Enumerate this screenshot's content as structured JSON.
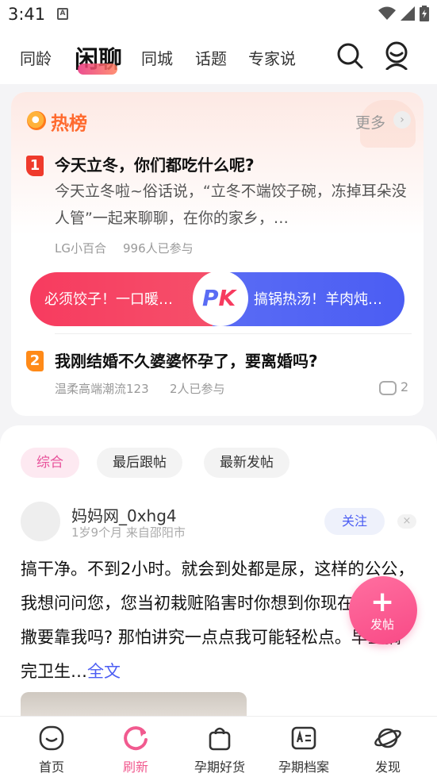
{
  "status_bar": {
    "time": "3:41",
    "notif_glyph": "A"
  },
  "nav": {
    "tabs": [
      {
        "label": "同龄"
      },
      {
        "label": "闲聊",
        "active": true
      },
      {
        "label": "同城"
      },
      {
        "label": "话题"
      },
      {
        "label": "专家说"
      }
    ],
    "search_icon": "search-icon",
    "profile_icon": "user-icon"
  },
  "hot_list": {
    "title": "热榜",
    "more_label": "更多",
    "more_arrow": "›",
    "items": [
      {
        "rank": "1",
        "title": "今天立冬，你们都吃什么呢?",
        "desc": "今天立冬啦~俗话说，“立冬不端饺子碗，冻掉耳朵没人管”一起来聊聊，在你的家乡，…",
        "author": "LG小百合",
        "participants": "996人已参与"
      },
      {
        "rank": "2",
        "title": "我刚结婚不久婆婆怀孕了，要离婚吗?",
        "author": "温柔高端潮流123",
        "participants": "2人已参与",
        "comment_count": "2"
      }
    ],
    "pk": {
      "left_text": "必须饺子！一口暖…",
      "right_text": "搞锅热汤！羊肉炖…",
      "p": "P",
      "k": "K"
    }
  },
  "feed": {
    "filters": [
      {
        "label": "综合",
        "active": true
      },
      {
        "label": "最后跟帖"
      },
      {
        "label": "最新发帖"
      }
    ],
    "post": {
      "username": "妈妈网_0xhg4",
      "sub": "1岁9个月 来自邵阳市",
      "follow_label": "关注",
      "close_glyph": "×",
      "text": "搞干净。不到2小时。就会到处都是尿，这样的公公，我想问问您，您当初栽赃陷害时你想到你现在吃喝拉撒要靠我吗? 那怕讲究一点点我可能轻松点。早上搞完卫生…",
      "read_more": "全文"
    }
  },
  "fab": {
    "plus": "+",
    "label": "发帖"
  },
  "bottom_nav": [
    {
      "label": "首页",
      "icon": "home-icon"
    },
    {
      "label": "刷新",
      "icon": "refresh-icon",
      "active": true
    },
    {
      "label": "孕期好货",
      "icon": "shopping-bag-icon"
    },
    {
      "label": "孕期档案",
      "icon": "profile-card-icon"
    },
    {
      "label": "发现",
      "icon": "planet-icon"
    }
  ],
  "colors": {
    "accent": "#f15a8f",
    "blue": "#4b5df3",
    "hot": "#ff6a2e"
  }
}
